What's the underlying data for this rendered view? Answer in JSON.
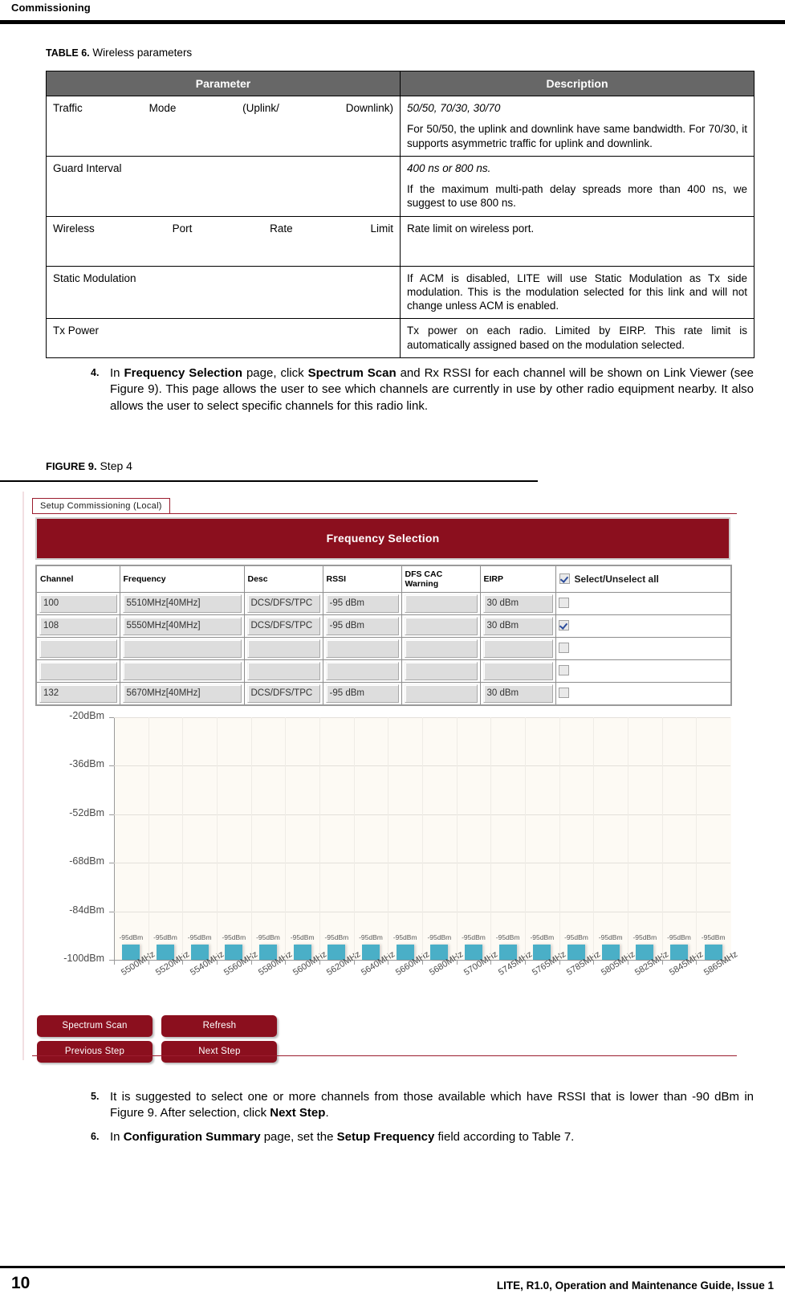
{
  "running_head": "Commissioning",
  "table": {
    "caption_label": "TABLE 6.",
    "caption_text": "Wireless parameters",
    "headers": [
      "Parameter",
      "Description"
    ],
    "rows": [
      {
        "parameter": "Traffic Mode (Uplink/ Downlink)",
        "desc_values": "50/50, 70/30, 30/70",
        "desc_body": "For 50/50, the uplink and downlink have same bandwidth. For 70/30, it supports asymmetric traffic for uplink and downlink."
      },
      {
        "parameter": "Guard Interval",
        "desc_values": "400 ns or 800 ns.",
        "desc_body": "If the maximum multi-path delay spreads more than 400 ns, we suggest to use 800 ns."
      },
      {
        "parameter": "Wireless Port Rate Limit",
        "desc_values": "Rate limit on wireless port.",
        "desc_body": ""
      },
      {
        "parameter": "Static Modulation",
        "desc_values": "If ACM is disabled, LITE will use Static Modulation as Tx side modulation. This is the modulation selected for this link and will not change unless ACM is enabled.",
        "desc_body": ""
      },
      {
        "parameter": "Tx Power",
        "desc_values": "Tx power on each radio. Limited by EIRP. This rate limit is automatically assigned based on the modulation selected.",
        "desc_body": ""
      }
    ]
  },
  "steps": {
    "step4": {
      "number": "4.",
      "part1": "In ",
      "bold1": "Frequency Selection",
      "part2": " page, click ",
      "bold2": "Spectrum Scan",
      "part3": " and Rx RSSI for each channel will be shown on Link Viewer (see Figure 9). This page allows the user to see which channels are currently in use by other radio equipment nearby. It also allows the user to select specific channels for this radio link."
    },
    "step5": {
      "number": "5.",
      "part1": "It is suggested to select one or more channels from those available which have RSSI that is lower than -90 dBm in Figure 9. After selection, click ",
      "bold1": "Next Step",
      "part2": "."
    },
    "step6": {
      "number": "6.",
      "part1": "In ",
      "bold1": "Configuration Summary",
      "part2": " page, set the ",
      "bold2": "Setup Frequency",
      "part3": " field according to Table 7."
    }
  },
  "figure": {
    "caption_label": "FIGURE 9.",
    "caption_text": "Step 4"
  },
  "app": {
    "tab_label": "Setup Commissioning (Local)",
    "title": "Frequency Selection",
    "grid": {
      "headers": [
        "Channel",
        "Frequency",
        "Desc",
        "RSSI",
        "DFS CAC Warning",
        "EIRP"
      ],
      "select_all_label": "Select/Unselect all",
      "select_all_checked": true,
      "rows": [
        {
          "channel": "100",
          "frequency": "5510MHz[40MHz]",
          "desc": "DCS/DFS/TPC",
          "rssi": "-95 dBm",
          "dfs": "",
          "eirp": "30 dBm",
          "checked": false
        },
        {
          "channel": "108",
          "frequency": "5550MHz[40MHz]",
          "desc": "DCS/DFS/TPC",
          "rssi": "-95 dBm",
          "dfs": "",
          "eirp": "30 dBm",
          "checked": true
        },
        {
          "channel": "",
          "frequency": "",
          "desc": "",
          "rssi": "",
          "dfs": "",
          "eirp": "",
          "checked": false
        },
        {
          "channel": "",
          "frequency": "",
          "desc": "",
          "rssi": "",
          "dfs": "",
          "eirp": "",
          "checked": false
        },
        {
          "channel": "132",
          "frequency": "5670MHz[40MHz]",
          "desc": "DCS/DFS/TPC",
          "rssi": "-95 dBm",
          "dfs": "",
          "eirp": "30 dBm",
          "checked": false
        }
      ]
    },
    "buttons": {
      "spectrum_scan": "Spectrum Scan",
      "refresh": "Refresh",
      "previous_step": "Previous Step",
      "next_step": "Next Step"
    },
    "colors": {
      "brand_red": "#8b0f1e",
      "bar_cyan": "#4aafc7",
      "plot_bg": "#fdfaf4"
    }
  },
  "chart_data": {
    "type": "bar",
    "title": "",
    "xlabel": "",
    "ylabel": "",
    "categories": [
      "5500MHz",
      "5520MHz",
      "5540MHz",
      "5560MHz",
      "5580MHz",
      "5600MHz",
      "5620MHz",
      "5640MHz",
      "5660MHz",
      "5680MHz",
      "5700MHz",
      "5745MHz",
      "5765MHz",
      "5785MHz",
      "5805MHz",
      "5825MHz",
      "5845MHz",
      "5865MHz"
    ],
    "values": [
      -95,
      -95,
      -95,
      -95,
      -95,
      -95,
      -95,
      -95,
      -95,
      -95,
      -95,
      -95,
      -95,
      -95,
      -95,
      -95,
      -95,
      -95
    ],
    "data_labels": [
      "-95dBm",
      "-95dBm",
      "-95dBm",
      "-95dBm",
      "-95dBm",
      "-95dBm",
      "-95dBm",
      "-95dBm",
      "-95dBm",
      "-95dBm",
      "-95dBm",
      "-95dBm",
      "-95dBm",
      "-95dBm",
      "-95dBm",
      "-95dBm",
      "-95dBm",
      "-95dBm"
    ],
    "ytick_labels": [
      "-20dBm",
      "-36dBm",
      "-52dBm",
      "-68dBm",
      "-84dBm",
      "-100dBm"
    ],
    "ytick_values": [
      -20,
      -36,
      -52,
      -68,
      -84,
      -100
    ],
    "ylim": [
      -100,
      -20
    ],
    "grid": true,
    "legend": "none",
    "series": [
      {
        "name": "RSSI",
        "values": [
          -95,
          -95,
          -95,
          -95,
          -95,
          -95,
          -95,
          -95,
          -95,
          -95,
          -95,
          -95,
          -95,
          -95,
          -95,
          -95,
          -95,
          -95
        ]
      }
    ]
  },
  "footer": {
    "page_number": "10",
    "text": "LITE, R1.0, Operation and Maintenance Guide, Issue 1"
  }
}
